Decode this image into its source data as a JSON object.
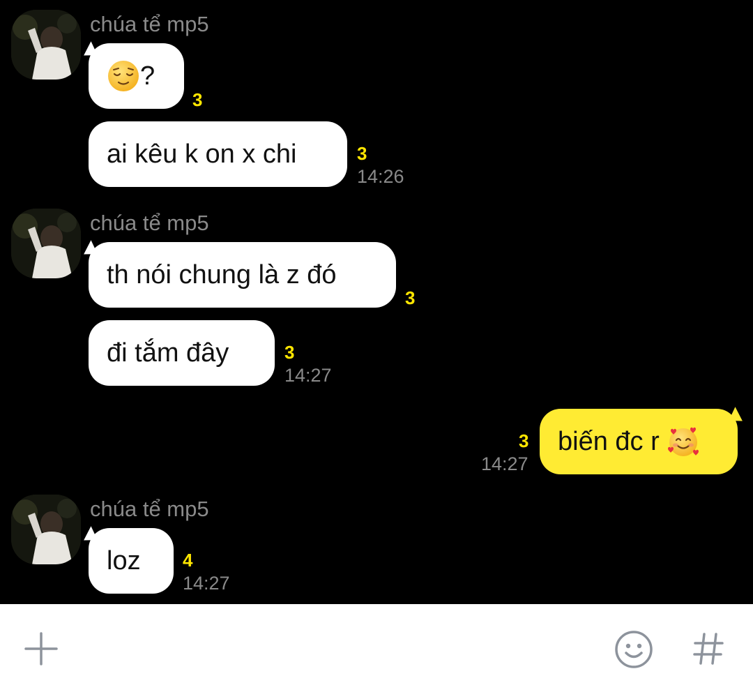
{
  "messages": [
    {
      "sender": "chúa tể mp5",
      "text": "?",
      "unread": "3",
      "time": ""
    },
    {
      "text": "ai kêu k on x chi",
      "unread": "3",
      "time": "14:26"
    },
    {
      "sender": "chúa tể mp5",
      "text": "th nói chung là z đó",
      "unread": "3",
      "time": ""
    },
    {
      "text": "đi tắm đây",
      "unread": "3",
      "time": "14:27"
    },
    {
      "text": "biến đc r",
      "unread": "3",
      "time": "14:27",
      "mine": true
    },
    {
      "sender": "chúa tể mp5",
      "text": "loz",
      "unread": "4",
      "time": "14:27"
    }
  ],
  "icons": {
    "relieved": "relieved-face-emoji",
    "hearts": "smiling-face-with-hearts-emoji",
    "plus": "plus-icon",
    "emoticon": "emoticon-icon",
    "hash": "hashtag-icon"
  },
  "colors": {
    "background": "#000000",
    "bubble_other": "#ffffff",
    "bubble_mine": "#ffeb33",
    "unread": "#ffe600",
    "meta": "#8a8a8a",
    "input_bar": "#ffffff"
  }
}
